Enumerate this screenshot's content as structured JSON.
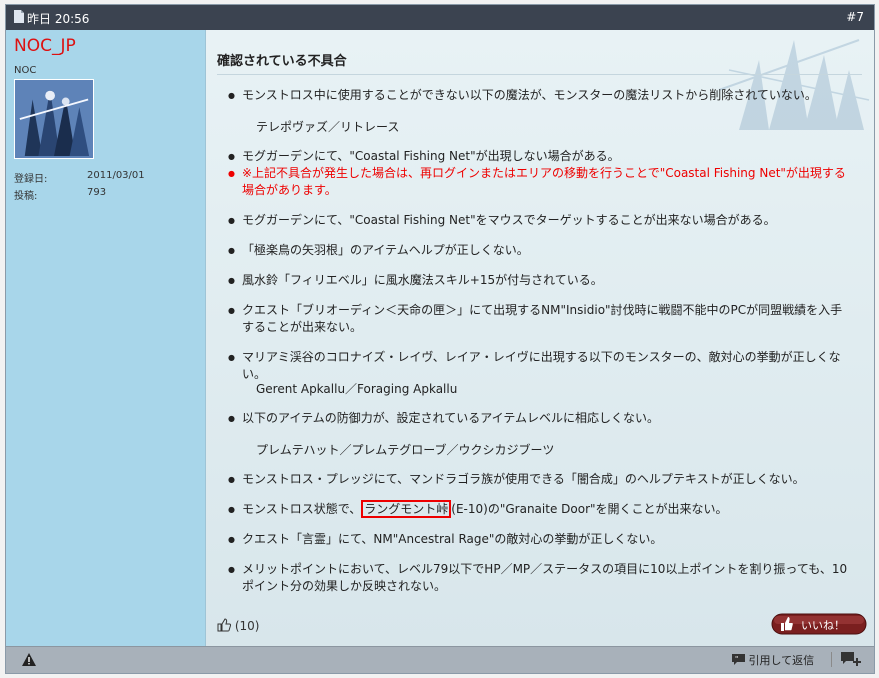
{
  "header": {
    "date": "昨日 20:56",
    "post_number": "#7"
  },
  "user": {
    "name": "NOC_JP",
    "title": "NOC",
    "joined_label": "登録日:",
    "joined_value": "2011/03/01",
    "posts_label": "投稿:",
    "posts_value": "793"
  },
  "post": {
    "title": "確認されている不具合",
    "items": [
      {
        "text": "モンストロス中に使用することができない以下の魔法が、モンスターの魔法リストから削除されていない。",
        "sub": "テレポヴァズ／リトレース"
      },
      {
        "text": "モグガーデンにて、\"Coastal Fishing Net\"が出現しない場合がある。",
        "note": "※上記不具合が発生した場合は、再ログインまたはエリアの移動を行うことで\"Coastal Fishing Net\"が出現する場合があります。"
      },
      {
        "text": "モグガーデンにて、\"Coastal Fishing Net\"をマウスでターゲットすることが出来ない場合がある。"
      },
      {
        "text": "「極楽鳥の矢羽根」のアイテムヘルプが正しくない。"
      },
      {
        "text": "風水鈴「フィリエベル」に風水魔法スキル+15が付与されている。"
      },
      {
        "text": "クエスト「ブリオーディン＜天命の匣＞」にて出現するNM\"Insidio\"討伐時に戦闘不能中のPCが同盟戦績を入手することが出来ない。"
      },
      {
        "text": "マリアミ渓谷のコロナイズ・レイヴ、レイア・レイヴに出現する以下のモンスターの、敵対心の挙動が正しくない。",
        "sub": "Gerent Apkallu／Foraging Apkallu"
      },
      {
        "text": "以下のアイテムの防御力が、設定されているアイテムレベルに相応しくない。",
        "sub": "プレムテハット／プレムテグローブ／ウクシカジブーツ"
      },
      {
        "text": "モンストロス・プレッジにて、マンドラゴラ族が使用できる「闇合成」のヘルプテキストが正しくない。"
      },
      {
        "pre": "モンストロス状態で、",
        "highlight": "ラングモント峠",
        "post": "(E-10)の\"Granaite Door\"を開くことが出来ない。"
      },
      {
        "text": "クエスト「言霊」にて、NM\"Ancestral Rage\"の敵対心の挙動が正しくない。"
      },
      {
        "text": "メリットポイントにおいて、レベル79以下でHP／MP／ステータスの項目に10以上ポイントを割り振っても、10ポイント分の効果しか反映されない。"
      }
    ]
  },
  "likes": {
    "count": "(10)",
    "button_label": "いいね！"
  },
  "footer": {
    "reply_quote_label": "引用して返信"
  },
  "colors": {
    "header_bg": "#3b4350",
    "sidebar_bg": "#a8d6ea",
    "username": "#dd1111",
    "note_red": "#ee0000"
  }
}
